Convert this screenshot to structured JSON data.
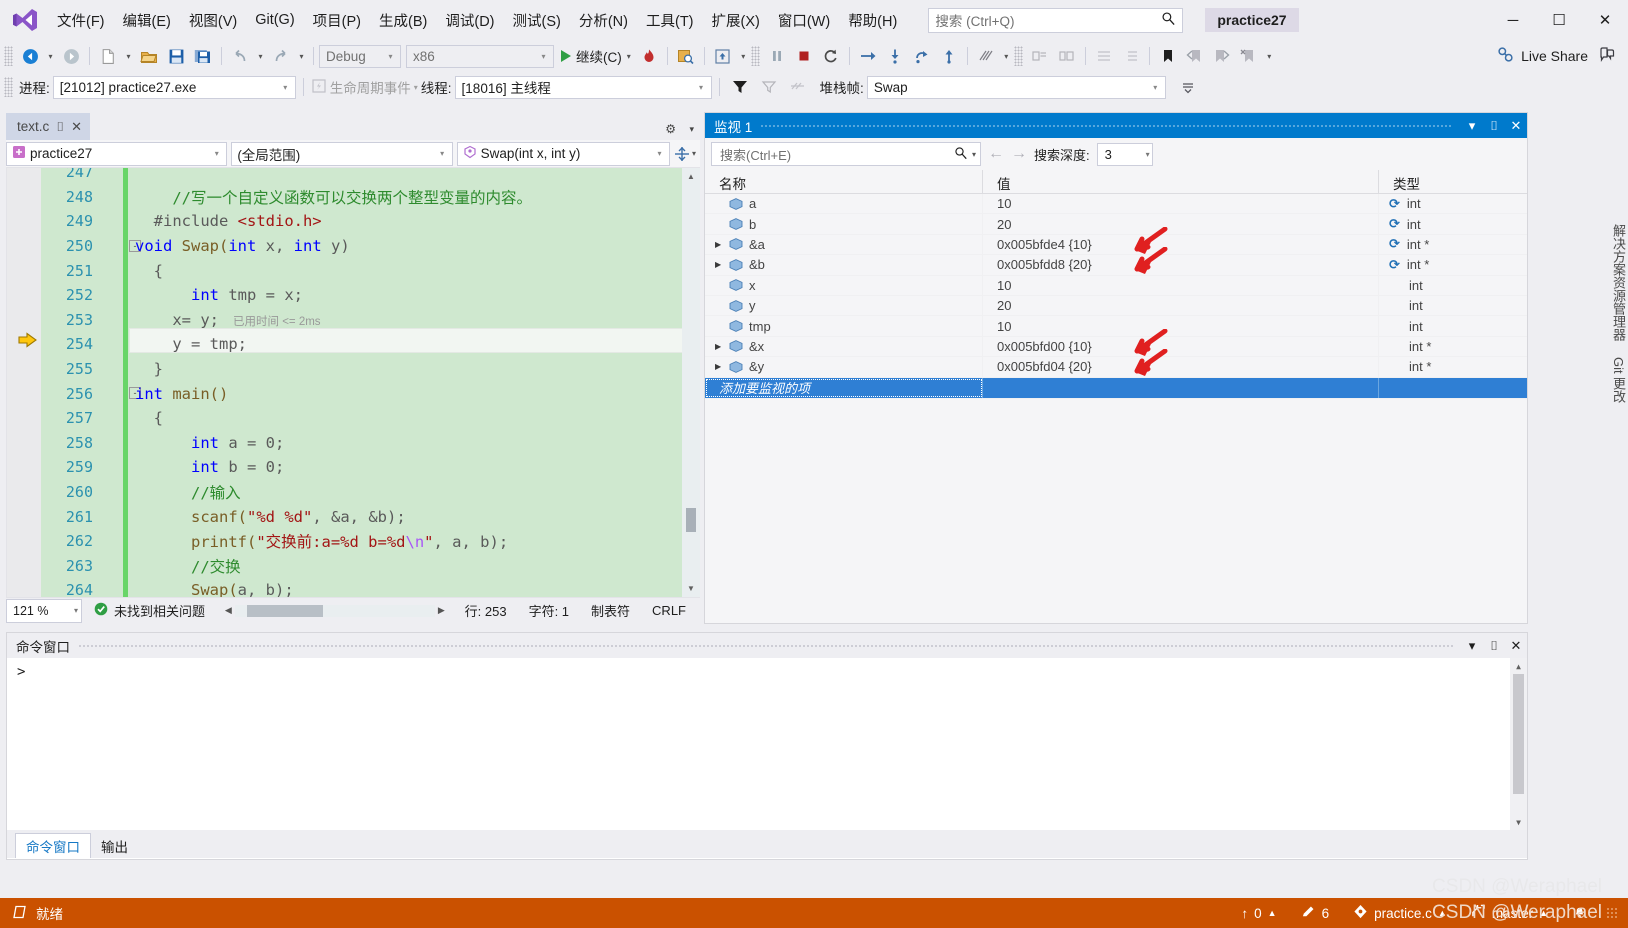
{
  "app": {
    "window_title": "practice27",
    "logo": "visual-studio-logo"
  },
  "menubar": {
    "items": [
      {
        "label": "文件(F)"
      },
      {
        "label": "编辑(E)"
      },
      {
        "label": "视图(V)"
      },
      {
        "label": "Git(G)"
      },
      {
        "label": "项目(P)"
      },
      {
        "label": "生成(B)"
      },
      {
        "label": "调试(D)"
      },
      {
        "label": "测试(S)"
      },
      {
        "label": "分析(N)"
      },
      {
        "label": "工具(T)"
      },
      {
        "label": "扩展(X)"
      },
      {
        "label": "窗口(W)"
      },
      {
        "label": "帮助(H)"
      }
    ],
    "search_placeholder": "搜索 (Ctrl+Q)",
    "live_share": "Live Share"
  },
  "window_controls": {
    "minimize": "─",
    "maximize": "☐",
    "close": "✕"
  },
  "toolbar": {
    "config": "Debug",
    "platform": "x86",
    "continue_label": "继续(C)",
    "icons": [
      "back-navigate-icon",
      "forward-navigate-icon",
      "new-file-icon",
      "open-file-icon",
      "save-icon",
      "save-all-icon",
      "undo-icon",
      "redo-icon"
    ]
  },
  "debugbar": {
    "process_label": "进程:",
    "process_value": "[21012] practice27.exe",
    "lifecycle_label": "生命周期事件",
    "thread_label": "线程:",
    "thread_value": "[18016] 主线程",
    "stackframe_label": "堆栈帧:",
    "stackframe_value": "Swap"
  },
  "editor": {
    "tab_name": "text.c",
    "nav": {
      "project": "practice27",
      "scope": "(全局范围)",
      "member": "Swap(int x, int y)"
    },
    "zoom": "121 %",
    "status": {
      "issues": "未找到相关问题",
      "line": "行: 253",
      "char": "字符: 1",
      "tabs": "制表符",
      "eol": "CRLF"
    },
    "elapsed_tip": "已用时间 <= 2ms",
    "current_line": 253,
    "lines": [
      {
        "num": 247,
        "text": "",
        "partial": true
      },
      {
        "num": 248,
        "segs": [
          {
            "t": "    //写一个自定义函数可以交换两个整型变量的内容。",
            "c": "cmt"
          }
        ]
      },
      {
        "num": 249,
        "segs": [
          {
            "t": "  #include ",
            "c": "pln"
          },
          {
            "t": "<stdio.h>",
            "c": "str"
          }
        ]
      },
      {
        "num": 250,
        "fold": "-",
        "segs": [
          {
            "t": "void",
            "c": "kw"
          },
          {
            "t": " Swap(",
            "c": "fn"
          },
          {
            "t": "int",
            "c": "kw"
          },
          {
            "t": " x, ",
            "c": "pln"
          },
          {
            "t": "int",
            "c": "kw"
          },
          {
            "t": " y)",
            "c": "pln"
          }
        ]
      },
      {
        "num": 251,
        "segs": [
          {
            "t": "  {",
            "c": "pln"
          }
        ]
      },
      {
        "num": 252,
        "segs": [
          {
            "t": "      ",
            "c": "pln"
          },
          {
            "t": "int",
            "c": "kw"
          },
          {
            "t": " tmp = x;",
            "c": "pln"
          }
        ]
      },
      {
        "num": 253,
        "segs": [
          {
            "t": "    x= y;",
            "c": "pln"
          }
        ]
      },
      {
        "num": 254,
        "segs": [
          {
            "t": "    y = tmp;",
            "c": "pln"
          }
        ]
      },
      {
        "num": 255,
        "segs": [
          {
            "t": "  }",
            "c": "pln"
          }
        ]
      },
      {
        "num": 256,
        "fold": "-",
        "segs": [
          {
            "t": "int",
            "c": "kw"
          },
          {
            "t": " main()",
            "c": "fn"
          }
        ]
      },
      {
        "num": 257,
        "segs": [
          {
            "t": "  {",
            "c": "pln"
          }
        ]
      },
      {
        "num": 258,
        "segs": [
          {
            "t": "      ",
            "c": "pln"
          },
          {
            "t": "int",
            "c": "kw"
          },
          {
            "t": " a = 0;",
            "c": "pln"
          }
        ]
      },
      {
        "num": 259,
        "segs": [
          {
            "t": "      ",
            "c": "pln"
          },
          {
            "t": "int",
            "c": "kw"
          },
          {
            "t": " b = 0;",
            "c": "pln"
          }
        ]
      },
      {
        "num": 260,
        "segs": [
          {
            "t": "      //输入",
            "c": "cmt"
          }
        ]
      },
      {
        "num": 261,
        "segs": [
          {
            "t": "      ",
            "c": "pln"
          },
          {
            "t": "scanf(",
            "c": "fn"
          },
          {
            "t": "\"%d %d\"",
            "c": "str"
          },
          {
            "t": ", &a, &b);",
            "c": "pln"
          }
        ]
      },
      {
        "num": 262,
        "segs": [
          {
            "t": "      ",
            "c": "pln"
          },
          {
            "t": "printf(",
            "c": "fn"
          },
          {
            "t": "\"交换前:a=%d b=%d",
            "c": "str"
          },
          {
            "t": "\\n",
            "c": "esc"
          },
          {
            "t": "\"",
            "c": "str"
          },
          {
            "t": ", a, b);",
            "c": "pln"
          }
        ]
      },
      {
        "num": 263,
        "segs": [
          {
            "t": "      //交换",
            "c": "cmt"
          }
        ]
      },
      {
        "num": 264,
        "segs": [
          {
            "t": "      ",
            "c": "pln"
          },
          {
            "t": "Swap(",
            "c": "fn"
          },
          {
            "t": "a, b);",
            "c": "pln"
          }
        ]
      }
    ]
  },
  "watch": {
    "title": "监视 1",
    "search_placeholder": "搜索(Ctrl+E)",
    "depth_label": "搜索深度:",
    "depth_value": "3",
    "columns": {
      "name": "名称",
      "value": "值",
      "type": "类型"
    },
    "add_row_placeholder": "添加要监视的项",
    "rows": [
      {
        "expandable": false,
        "name": "a",
        "value": "10",
        "type": "int",
        "refresh": true,
        "arrow": false
      },
      {
        "expandable": false,
        "name": "b",
        "value": "20",
        "type": "int",
        "refresh": true,
        "arrow": false
      },
      {
        "expandable": true,
        "name": "&a",
        "value": "0x005bfde4 {10}",
        "type": "int *",
        "refresh": true,
        "arrow": true
      },
      {
        "expandable": true,
        "name": "&b",
        "value": "0x005bfdd8 {20}",
        "type": "int *",
        "refresh": true,
        "arrow": true
      },
      {
        "expandable": false,
        "name": "x",
        "value": "10",
        "type": "int",
        "refresh": false,
        "arrow": false
      },
      {
        "expandable": false,
        "name": "y",
        "value": "20",
        "type": "int",
        "refresh": false,
        "arrow": false
      },
      {
        "expandable": false,
        "name": "tmp",
        "value": "10",
        "type": "int",
        "refresh": false,
        "arrow": false
      },
      {
        "expandable": true,
        "name": "&x",
        "value": "0x005bfd00 {10}",
        "type": "int *",
        "refresh": false,
        "arrow": true
      },
      {
        "expandable": true,
        "name": "&y",
        "value": "0x005bfd04 {20}",
        "type": "int *",
        "refresh": false,
        "arrow": true
      }
    ]
  },
  "vertical_tabs": [
    {
      "label": "解决方案资源管理器"
    },
    {
      "label": "Git 更改"
    }
  ],
  "command_window": {
    "title": "命令窗口",
    "prompt": ">",
    "tabs": [
      {
        "label": "命令窗口",
        "active": true
      },
      {
        "label": "输出",
        "active": false
      }
    ]
  },
  "statusbar": {
    "ready": "就绪",
    "push_count": "0",
    "edit_count": "6",
    "file": "practice.c",
    "branch": "master",
    "watermark": "CSDN @Weraphael"
  },
  "colors": {
    "accent_blue": "#007acc",
    "debug_orange": "#ca5100",
    "chrome": "#eeeef2",
    "code_bg_changed": "#cfe8cf",
    "change_bar_green": "#68d568",
    "arrow_red": "#e02020"
  }
}
